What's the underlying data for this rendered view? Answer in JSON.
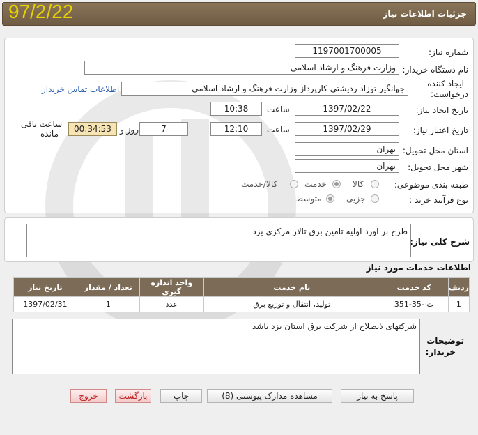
{
  "header": {
    "title": "جزئیات اطلاعات نیاز",
    "date_stamp": "97/2/22"
  },
  "form": {
    "need_number_label": "شماره نیاز:",
    "need_number": "1197001700005",
    "buyer_org_label": "نام دستگاه خریدار:",
    "buyer_org": "وزارت فرهنگ و ارشاد اسلامی",
    "creator_label_1": "ایجاد کننده",
    "creator_label_2": "درخواست:",
    "creator": "جهانگیر توزاد ردیشتی کارپرداز وزارت فرهنگ و ارشاد اسلامی",
    "contact_link": "اطلاعات تماس خریدار",
    "created_date_label": "تاریخ ایجاد نیاز:",
    "created_date": "1397/02/22",
    "time_label": "ساعت",
    "created_time": "10:38",
    "validity_label": "تاریخ اعتبار نیاز:",
    "validity_date": "1397/02/29",
    "validity_time": "12:10",
    "days_value": "7",
    "days_label": "روز و",
    "remaining_time": "00:34:53",
    "remaining_label_1": "ساعت باقی",
    "remaining_label_2": "مانده",
    "province_label": "استان محل تحویل:",
    "province": "تهران",
    "city_label": "شهر محل تحویل:",
    "city": "تهران",
    "category_label": "طبقه بندی موضوعی:",
    "category_options": [
      "کالا",
      "خدمت",
      "کالا/خدمت"
    ],
    "category_selected": "خدمت",
    "process_label": "نوع فرآیند خرید :",
    "process_options": [
      "جزیی",
      "متوسط"
    ],
    "process_selected": "متوسط"
  },
  "summary": {
    "label": "شرح کلی نیاز:",
    "text": "طرح بر آورد اولیه تامین برق تالار مرکزی یزد"
  },
  "services": {
    "title": "اطلاعات خدمات مورد نیاز",
    "columns": [
      "ردیف",
      "کد خدمت",
      "نام خدمت",
      "واحد اندازه گیری",
      "تعداد / مقدار",
      "تاریخ نیاز"
    ],
    "rows": [
      [
        "1",
        "ت -35-351",
        "تولید، انتقال و توزیع برق",
        "عدد",
        "1",
        "1397/02/31"
      ]
    ]
  },
  "buyer_notes": {
    "label_1": "توضیحات",
    "label_2": "خریدار:",
    "text": "شرکتهای ذیصلاح از شرکت برق استان  یزد باشد"
  },
  "buttons": {
    "reply": "پاسخ به نیاز",
    "attachments": "مشاهده مدارک پیوستی (8)",
    "print": "چاپ",
    "back": "بازگشت",
    "exit": "خروج"
  }
}
